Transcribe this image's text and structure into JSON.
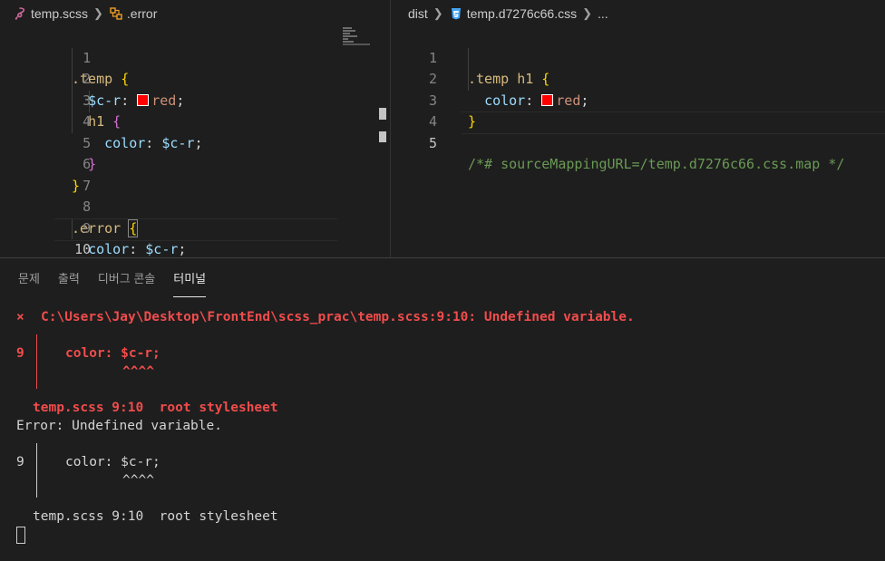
{
  "left_editor": {
    "breadcrumb": {
      "file": "temp.scss",
      "symbol": ".error"
    },
    "line_numbers": [
      "1",
      "2",
      "3",
      "4",
      "5",
      "6",
      "7",
      "8",
      "9",
      "10"
    ],
    "code": {
      "l1_sel": ".temp",
      "l1_brace": "{",
      "l2_var": "$c-r",
      "l2_colon": ":",
      "l2_val": "red",
      "l2_semi": ";",
      "l3_sel": "h1",
      "l3_brace": "{",
      "l4_prop": "color",
      "l4_colon": ":",
      "l4_var": "$c-r",
      "l4_semi": ";",
      "l5_brace": "}",
      "l6_brace": "}",
      "l8_sel": ".error",
      "l8_brace": "{",
      "l9_prop": "color",
      "l9_colon": ":",
      "l9_var": "$c-r",
      "l9_semi": ";",
      "l10_brace": "}"
    }
  },
  "right_editor": {
    "breadcrumb": {
      "folder": "dist",
      "file": "temp.d7276c66.css",
      "more": "..."
    },
    "line_numbers": [
      "1",
      "2",
      "3",
      "4",
      "5"
    ],
    "code": {
      "l1_sel": ".temp",
      "l1_tag": "h1",
      "l1_brace": "{",
      "l2_prop": "color",
      "l2_colon": ":",
      "l2_val": "red",
      "l2_semi": ";",
      "l3_brace": "}",
      "l5_comment": "/*# sourceMappingURL=/temp.d7276c66.css.map */"
    }
  },
  "panel": {
    "tabs": [
      {
        "label": "문제",
        "active": false
      },
      {
        "label": "출력",
        "active": false
      },
      {
        "label": "디버그 콘솔",
        "active": false
      },
      {
        "label": "터미널",
        "active": true
      }
    ]
  },
  "terminal": {
    "error_mark": "×",
    "error_header": "C:\\Users\\Jay\\Desktop\\FrontEnd\\scss_prac\\temp.scss:9:10: Undefined variable.",
    "block1_line_no": "9",
    "block1_code": "color: $c-r;",
    "block1_caret": "^^^^",
    "block1_trace": "temp.scss 9:10  root stylesheet",
    "error_message": "Error: Undefined variable.",
    "block2_line_no": "9",
    "block2_code": "color: $c-r;",
    "block2_caret": "^^^^",
    "block2_trace": "temp.scss 9:10  root stylesheet"
  },
  "colors": {
    "error_red": "#f14c4c",
    "swatch_red": "#ff0000",
    "background": "#1e1e1e"
  }
}
